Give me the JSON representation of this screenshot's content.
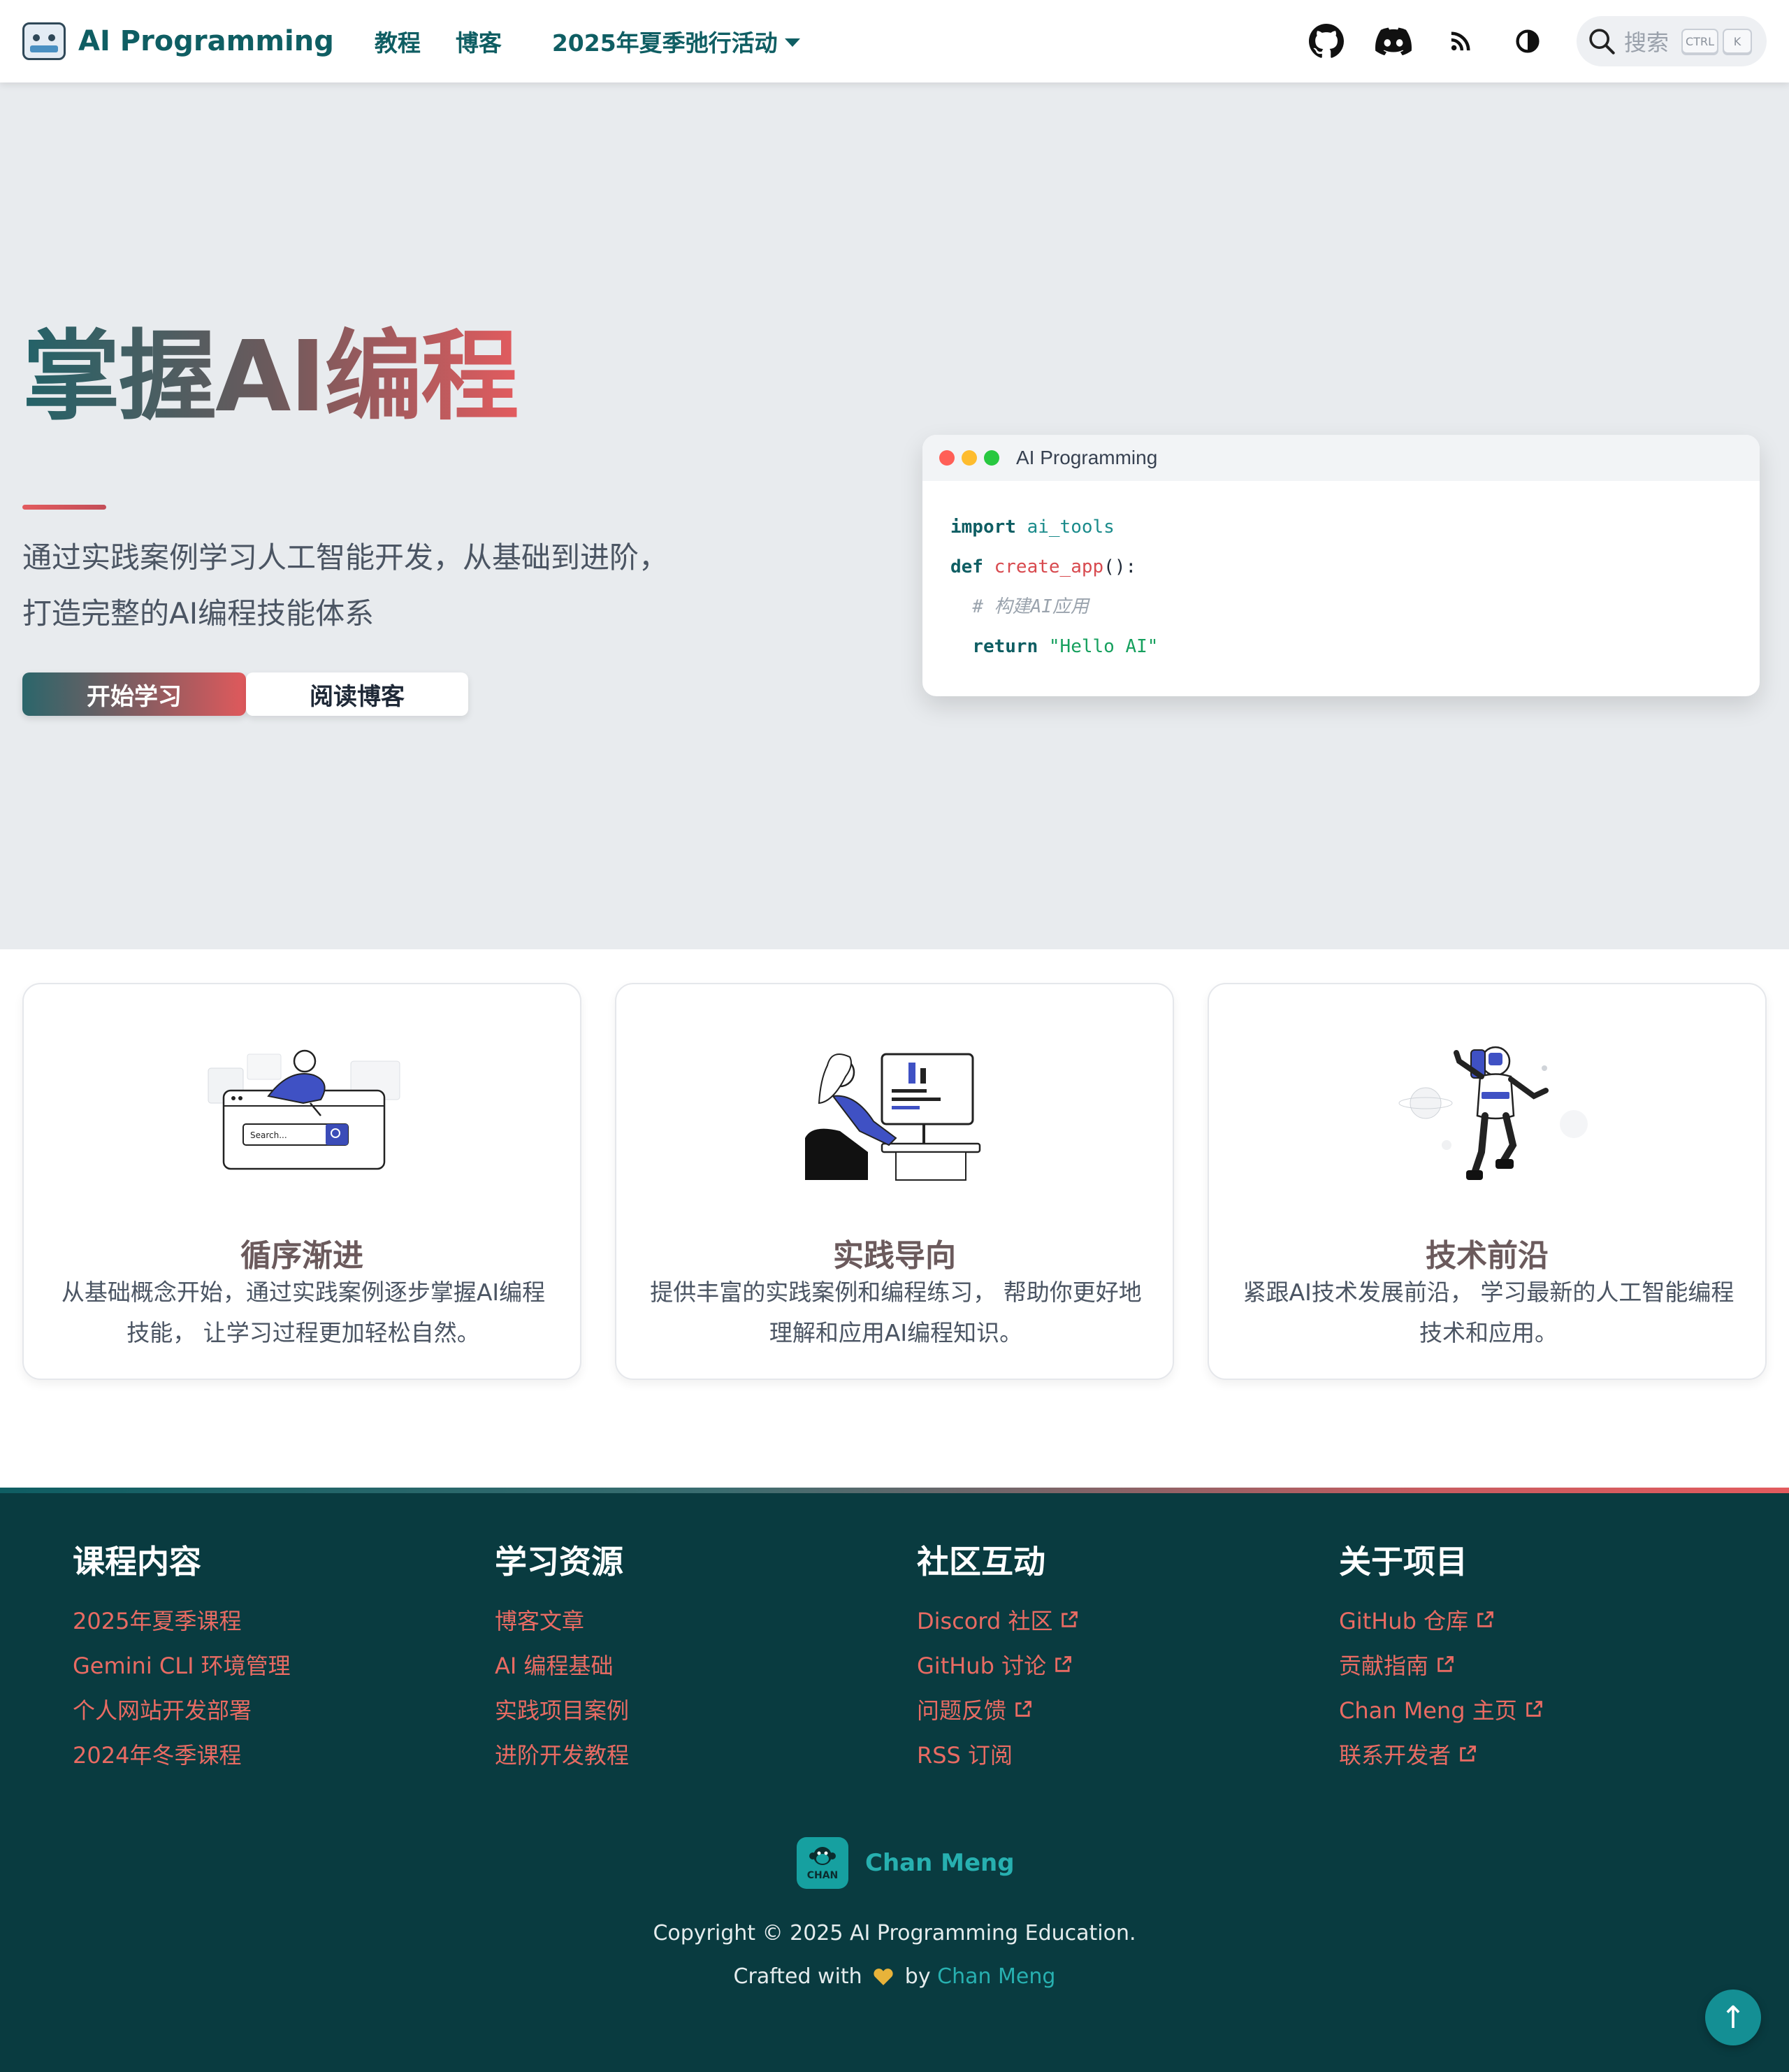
{
  "nav": {
    "brand": "AI Programming",
    "links": [
      "教程",
      "博客"
    ],
    "dropdown": "2025年夏季弛行活动",
    "icons": [
      "github-icon",
      "discord-icon",
      "rss-icon",
      "theme-toggle-icon"
    ],
    "search_placeholder": "搜索",
    "kbd": [
      "CTRL",
      "K"
    ]
  },
  "hero": {
    "title": "掌握AI编程",
    "subtitle_line1": "通过实践案例学习人工智能开发，从基础到进阶，",
    "subtitle_line2": "打造完整的AI编程技能体系",
    "primary_button": "开始学习",
    "secondary_button": "阅读博客"
  },
  "code_window": {
    "title": "AI Programming",
    "lines": [
      {
        "kw": "import",
        "rest": "ai_tools"
      },
      {
        "kw": "def",
        "fn": "create_app",
        "rest": "():"
      },
      {
        "comment": "# 构建AI应用"
      },
      {
        "kw": "return",
        "str": "\"Hello AI\""
      }
    ],
    "dot_colors": [
      "#ff5f57",
      "#febc2e",
      "#28c840"
    ]
  },
  "features": [
    {
      "title": "循序渐进",
      "desc": "从基础概念开始，通过实践案例逐步掌握AI编程技能， 让学习过程更加轻松自然。",
      "illustration": "search-illustration"
    },
    {
      "title": "实践导向",
      "desc": "提供丰富的实践案例和编程练习， 帮助你更好地理解和应用AI编程知识。",
      "illustration": "coding-illustration"
    },
    {
      "title": "技术前沿",
      "desc": "紧跟AI技术发展前沿， 学习最新的人工智能编程技术和应用。",
      "illustration": "astronaut-illustration"
    }
  ],
  "footer": {
    "columns": [
      {
        "title": "课程内容",
        "links": [
          {
            "label": "2025年夏季课程",
            "external": false
          },
          {
            "label": "Gemini CLI 环境管理",
            "external": false
          },
          {
            "label": "个人网站开发部署",
            "external": false
          },
          {
            "label": "2024年冬季课程",
            "external": false
          }
        ]
      },
      {
        "title": "学习资源",
        "links": [
          {
            "label": "博客文章",
            "external": false
          },
          {
            "label": "AI 编程基础",
            "external": false
          },
          {
            "label": "实践项目案例",
            "external": false
          },
          {
            "label": "进阶开发教程",
            "external": false
          }
        ]
      },
      {
        "title": "社区互动",
        "links": [
          {
            "label": "Discord 社区",
            "external": true
          },
          {
            "label": "GitHub 讨论",
            "external": true
          },
          {
            "label": "问题反馈",
            "external": true
          },
          {
            "label": "RSS 订阅",
            "external": false
          }
        ]
      },
      {
        "title": "关于项目",
        "links": [
          {
            "label": "GitHub 仓库",
            "external": true
          },
          {
            "label": "贡献指南",
            "external": true
          },
          {
            "label": "Chan Meng 主页",
            "external": true
          },
          {
            "label": "联系开发者",
            "external": true
          }
        ]
      }
    ],
    "brand_name": "Chan Meng",
    "brand_logo_text": "CHAN",
    "copyright": "Copyright © 2025 AI Programming Education.",
    "crafted_prefix": "Crafted with",
    "crafted_by": "by",
    "crafted_author": "Chan Meng",
    "back_to_top": "↑"
  },
  "colors": {
    "brand": "#0f5e63",
    "accent": "#e25b5e",
    "footer_bg": "#093b40",
    "footer_link": "#e96b63",
    "hero_bg": "#e8ebee"
  }
}
